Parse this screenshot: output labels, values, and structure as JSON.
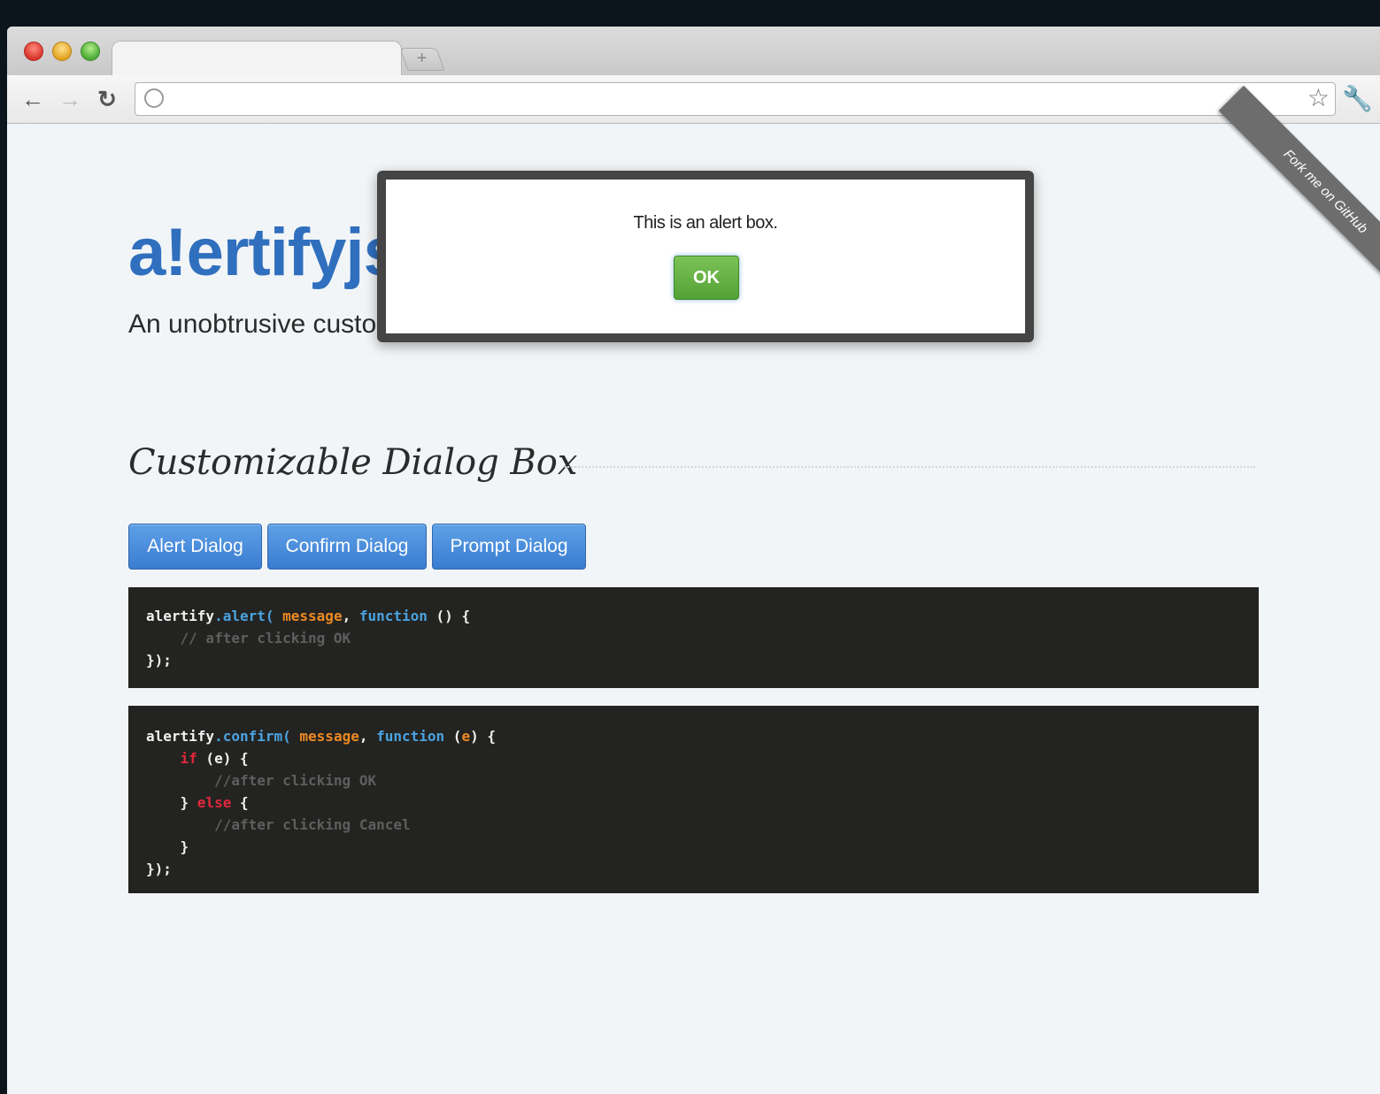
{
  "browser": {
    "new_tab_label": "+"
  },
  "ribbon": {
    "text": "Fork me on GitHub"
  },
  "page": {
    "logo": "a!ertifyjs",
    "tagline": "An unobtrusive customizable JavaScript notification system",
    "section_title": "Customizable Dialog Box",
    "buttons": {
      "alert": "Alert Dialog",
      "confirm": "Confirm Dialog",
      "prompt": "Prompt Dialog"
    }
  },
  "code": {
    "alert": {
      "line1": {
        "obj": "alertify",
        "method": ".alert(",
        "arg": "message",
        "sep": ", ",
        "fn": "function",
        "rest": " () {"
      },
      "line2": "// after clicking OK",
      "line3": "});"
    },
    "confirm": {
      "line1": {
        "obj": "alertify",
        "method": ".confirm(",
        "arg": "message",
        "sep": ", ",
        "fn": "function",
        "rest_open": " (",
        "param": "e",
        "rest_close": ") {"
      },
      "line2": {
        "kw": "if",
        "rest": " (e) {"
      },
      "line3": "//after clicking OK",
      "line4": {
        "pre": "} ",
        "kw": "else",
        "rest": " {"
      },
      "line5": "//after clicking Cancel",
      "line6": "}",
      "line7": "});"
    }
  },
  "modal": {
    "message": "This is an alert box.",
    "ok_label": "OK"
  },
  "colors": {
    "accent_blue": "#2f6fbe",
    "ok_green": "#53a237",
    "code_bg": "#232321"
  }
}
